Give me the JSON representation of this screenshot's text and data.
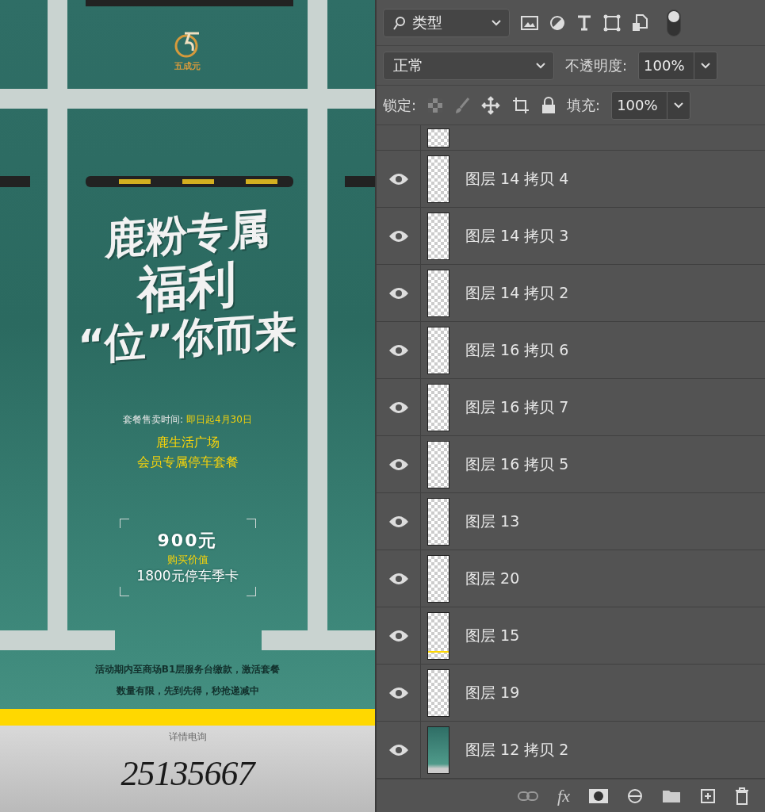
{
  "poster": {
    "logo_text": "五成元",
    "headline": [
      "鹿粉专属",
      "福利",
      "“位”你而来"
    ],
    "sale_label": "套餐售卖时间:",
    "sale_date": "即日起4月30日",
    "venue": "鹿生活广场",
    "package": "会员专属停车套餐",
    "price": "900元",
    "value_label": "购买价值",
    "value": "1800元停车季卡",
    "notes": [
      "活动期内至商场B1层服务台缴款，激活套餐",
      "数量有限，先到先得，秒抢递减中"
    ],
    "hotline_label": "详情电询",
    "phone": "25135667"
  },
  "layers_panel": {
    "filter": "类型",
    "filter_on": true,
    "blend_mode": "正常",
    "opacity_label": "不透明度:",
    "opacity": "100%",
    "lock_label": "锁定:",
    "fill_label": "填充:",
    "fill": "100%",
    "layers": [
      {
        "name": "图层 14 拷贝 4",
        "visible": true,
        "kind": "transparent"
      },
      {
        "name": "图层 14 拷贝 3",
        "visible": true,
        "kind": "transparent"
      },
      {
        "name": "图层 14 拷贝 2",
        "visible": true,
        "kind": "transparent"
      },
      {
        "name": "图层 16 拷贝 6",
        "visible": true,
        "kind": "transparent"
      },
      {
        "name": "图层 16 拷贝 7",
        "visible": true,
        "kind": "transparent"
      },
      {
        "name": "图层 16 拷贝 5",
        "visible": true,
        "kind": "transparent"
      },
      {
        "name": "图层 13",
        "visible": true,
        "kind": "transparent"
      },
      {
        "name": "图层 20",
        "visible": true,
        "kind": "transparent"
      },
      {
        "name": "图层 15",
        "visible": true,
        "kind": "line"
      },
      {
        "name": "图层 19",
        "visible": true,
        "kind": "transparent"
      },
      {
        "name": "图层 12 拷贝 2",
        "visible": true,
        "kind": "poster"
      }
    ],
    "fx": "fx"
  }
}
